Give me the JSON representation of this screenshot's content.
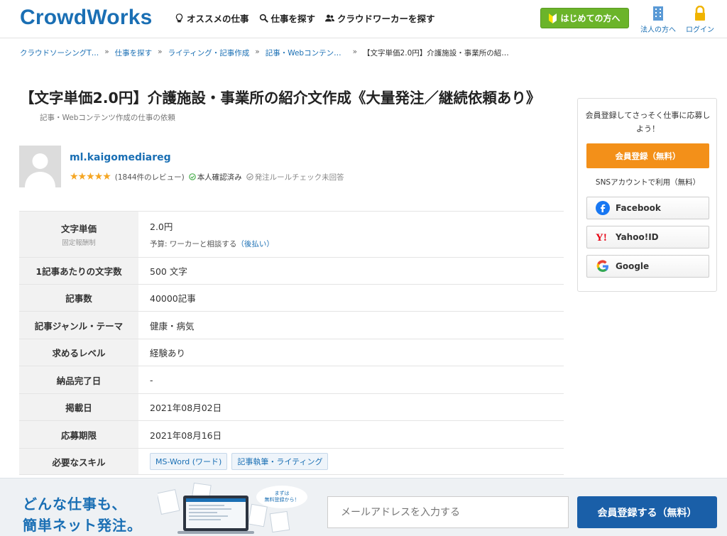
{
  "header": {
    "logo": "CrowdWorks",
    "nav": [
      {
        "label": "オススメの仕事",
        "icon": "lightbulb-icon"
      },
      {
        "label": "仕事を探す",
        "icon": "search-icon"
      },
      {
        "label": "クラウドワーカーを探す",
        "icon": "users-icon"
      }
    ],
    "start_button": "はじめての方へ",
    "corporate_label": "法人の方へ",
    "login_label": "ログイン"
  },
  "breadcrumb": {
    "items": [
      "クラウドソーシングT…",
      "仕事を探す",
      "ライティング・記事作成",
      "記事・Webコンテン…"
    ],
    "current": "【文字単価2.0円】介護施設・事業所の紹…",
    "separator": "»"
  },
  "job": {
    "title": "【文字単価2.0円】介護施設・事業所の紹介文作成《大量発注／継続依頼あり》",
    "category": "記事・Webコンテンツ作成の仕事の依頼"
  },
  "client": {
    "name": "ml.kaigomediareg",
    "stars": "★★★★★",
    "rating": 5,
    "reviews": "(1844件のレビュー)",
    "verified": "本人確認済み",
    "rule_check": "発注ルールチェック未回答"
  },
  "details": {
    "price_label": "文字単価",
    "price_note": "固定報酬制",
    "price_value": "2.0円",
    "budget_prefix": "予算: ワーカーと相談する",
    "budget_link": "（後払い）",
    "chars_label": "1記事あたりの文字数",
    "chars_value": "500 文字",
    "count_label": "記事数",
    "count_value": "40000記事",
    "genre_label": "記事ジャンル・テーマ",
    "genre_value": "健康・病気",
    "level_label": "求めるレベル",
    "level_value": "経験あり",
    "delivery_label": "納品完了日",
    "delivery_value": "-",
    "posted_label": "掲載日",
    "posted_value": "2021年08月02日",
    "deadline_label": "応募期限",
    "deadline_value": "2021年08月16日",
    "skills_label": "必要なスキル",
    "skills": [
      "MS-Word (ワード)",
      "記事執筆・ライティング"
    ]
  },
  "sidebar": {
    "message": "会員登録してさっそく仕事に応募しよう！",
    "register_button": "会員登録（無料）",
    "sns_label": "SNSアカウントで利用（無料）",
    "facebook": "Facebook",
    "yahoo": "Yahoo!ID",
    "google": "Google"
  },
  "banner": {
    "copy_line1": "どんな仕事も、",
    "copy_line2": "簡単ネット発注。",
    "bubble": "まずは 無料登録から！",
    "email_placeholder": "メールアドレスを入力する",
    "button": "会員登録する（無料）"
  },
  "colors": {
    "brand_blue": "#1a6fb4",
    "green": "#6bb42a",
    "orange": "#f39019",
    "star": "#f5a623"
  }
}
